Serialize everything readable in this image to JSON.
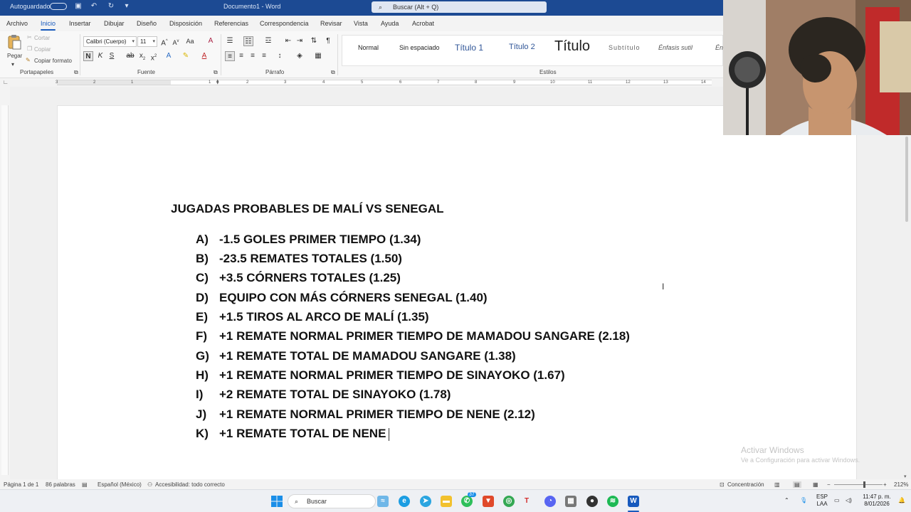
{
  "titlebar": {
    "autosave_label": "Autoguardado",
    "doc_title": "Documento1 - Word",
    "search_placeholder": "Buscar (Alt + Q)"
  },
  "tabs": [
    "Archivo",
    "Inicio",
    "Insertar",
    "Dibujar",
    "Diseño",
    "Disposición",
    "Referencias",
    "Correspondencia",
    "Revisar",
    "Vista",
    "Ayuda",
    "Acrobat"
  ],
  "active_tab": "Inicio",
  "ribbon": {
    "clipboard": {
      "paste": "Pegar",
      "cut": "Cortar",
      "copy": "Copiar",
      "format_painter": "Copiar formato",
      "label": "Portapapeles"
    },
    "font": {
      "font_name": "Calibri (Cuerpo)",
      "font_size": "11",
      "label": "Fuente"
    },
    "paragraph": {
      "label": "Párrafo"
    },
    "styles": {
      "label": "Estilos",
      "items": [
        "Normal",
        "Sin espaciado",
        "Título 1",
        "Título 2",
        "Título",
        "Subtítulo",
        "Énfasis sutil",
        "Én"
      ]
    }
  },
  "ruler_numbers": [
    "3",
    "2",
    "1",
    "1",
    "2",
    "3",
    "4",
    "5",
    "6",
    "7",
    "8",
    "9",
    "10",
    "11",
    "12",
    "13",
    "14"
  ],
  "document": {
    "heading": "JUGADAS PROBABLES DE MALÍ VS SENEGAL",
    "items": [
      {
        "letter": "A)",
        "text": "-1.5 GOLES PRIMER TIEMPO (1.34)"
      },
      {
        "letter": "B)",
        "text": "-23.5 REMATES TOTALES (1.50)"
      },
      {
        "letter": "C)",
        "text": "+3.5 CÓRNERS TOTALES (1.25)"
      },
      {
        "letter": "D)",
        "text": "EQUIPO CON MÁS CÓRNERS SENEGAL (1.40)"
      },
      {
        "letter": "E)",
        "text": "+1.5 TIROS AL ARCO DE MALÍ (1.35)"
      },
      {
        "letter": "F)",
        "text": "+1 REMATE NORMAL PRIMER TIEMPO DE MAMADOU SANGARE (2.18)"
      },
      {
        "letter": "G)",
        "text": "+1 REMATE TOTAL DE MAMADOU SANGARE (1.38)"
      },
      {
        "letter": "H)",
        "text": "+1 REMATE NORMAL PRIMER TIEMPO DE SINAYOKO (1.67)"
      },
      {
        "letter": "I)",
        "text": "+2 REMATE TOTAL DE SINAYOKO (1.78)"
      },
      {
        "letter": "J)",
        "text": "+1 REMATE NORMAL PRIMER TIEMPO DE NENE (2.12)"
      },
      {
        "letter": "K)",
        "text": "+1 REMATE TOTAL DE NENE"
      }
    ]
  },
  "watermark": {
    "line1": "Activar Windows",
    "line2": "Ve a Configuración para activar Windows."
  },
  "statusbar": {
    "page": "Página 1 de 1",
    "words": "86 palabras",
    "language": "Español (México)",
    "accessibility": "Accesibilidad: todo correcto",
    "focus": "Concentración",
    "zoom": "212%"
  },
  "taskbar": {
    "search_placeholder": "Buscar",
    "whatsapp_badge": "37",
    "lang_top": "ESP",
    "lang_bottom": "LAA",
    "time": "11:47 p. m.",
    "date": "8/01/2026"
  },
  "colors": {
    "titlebar": "#1c4a93",
    "accent": "#185abd",
    "word_icon": "#185abd"
  }
}
